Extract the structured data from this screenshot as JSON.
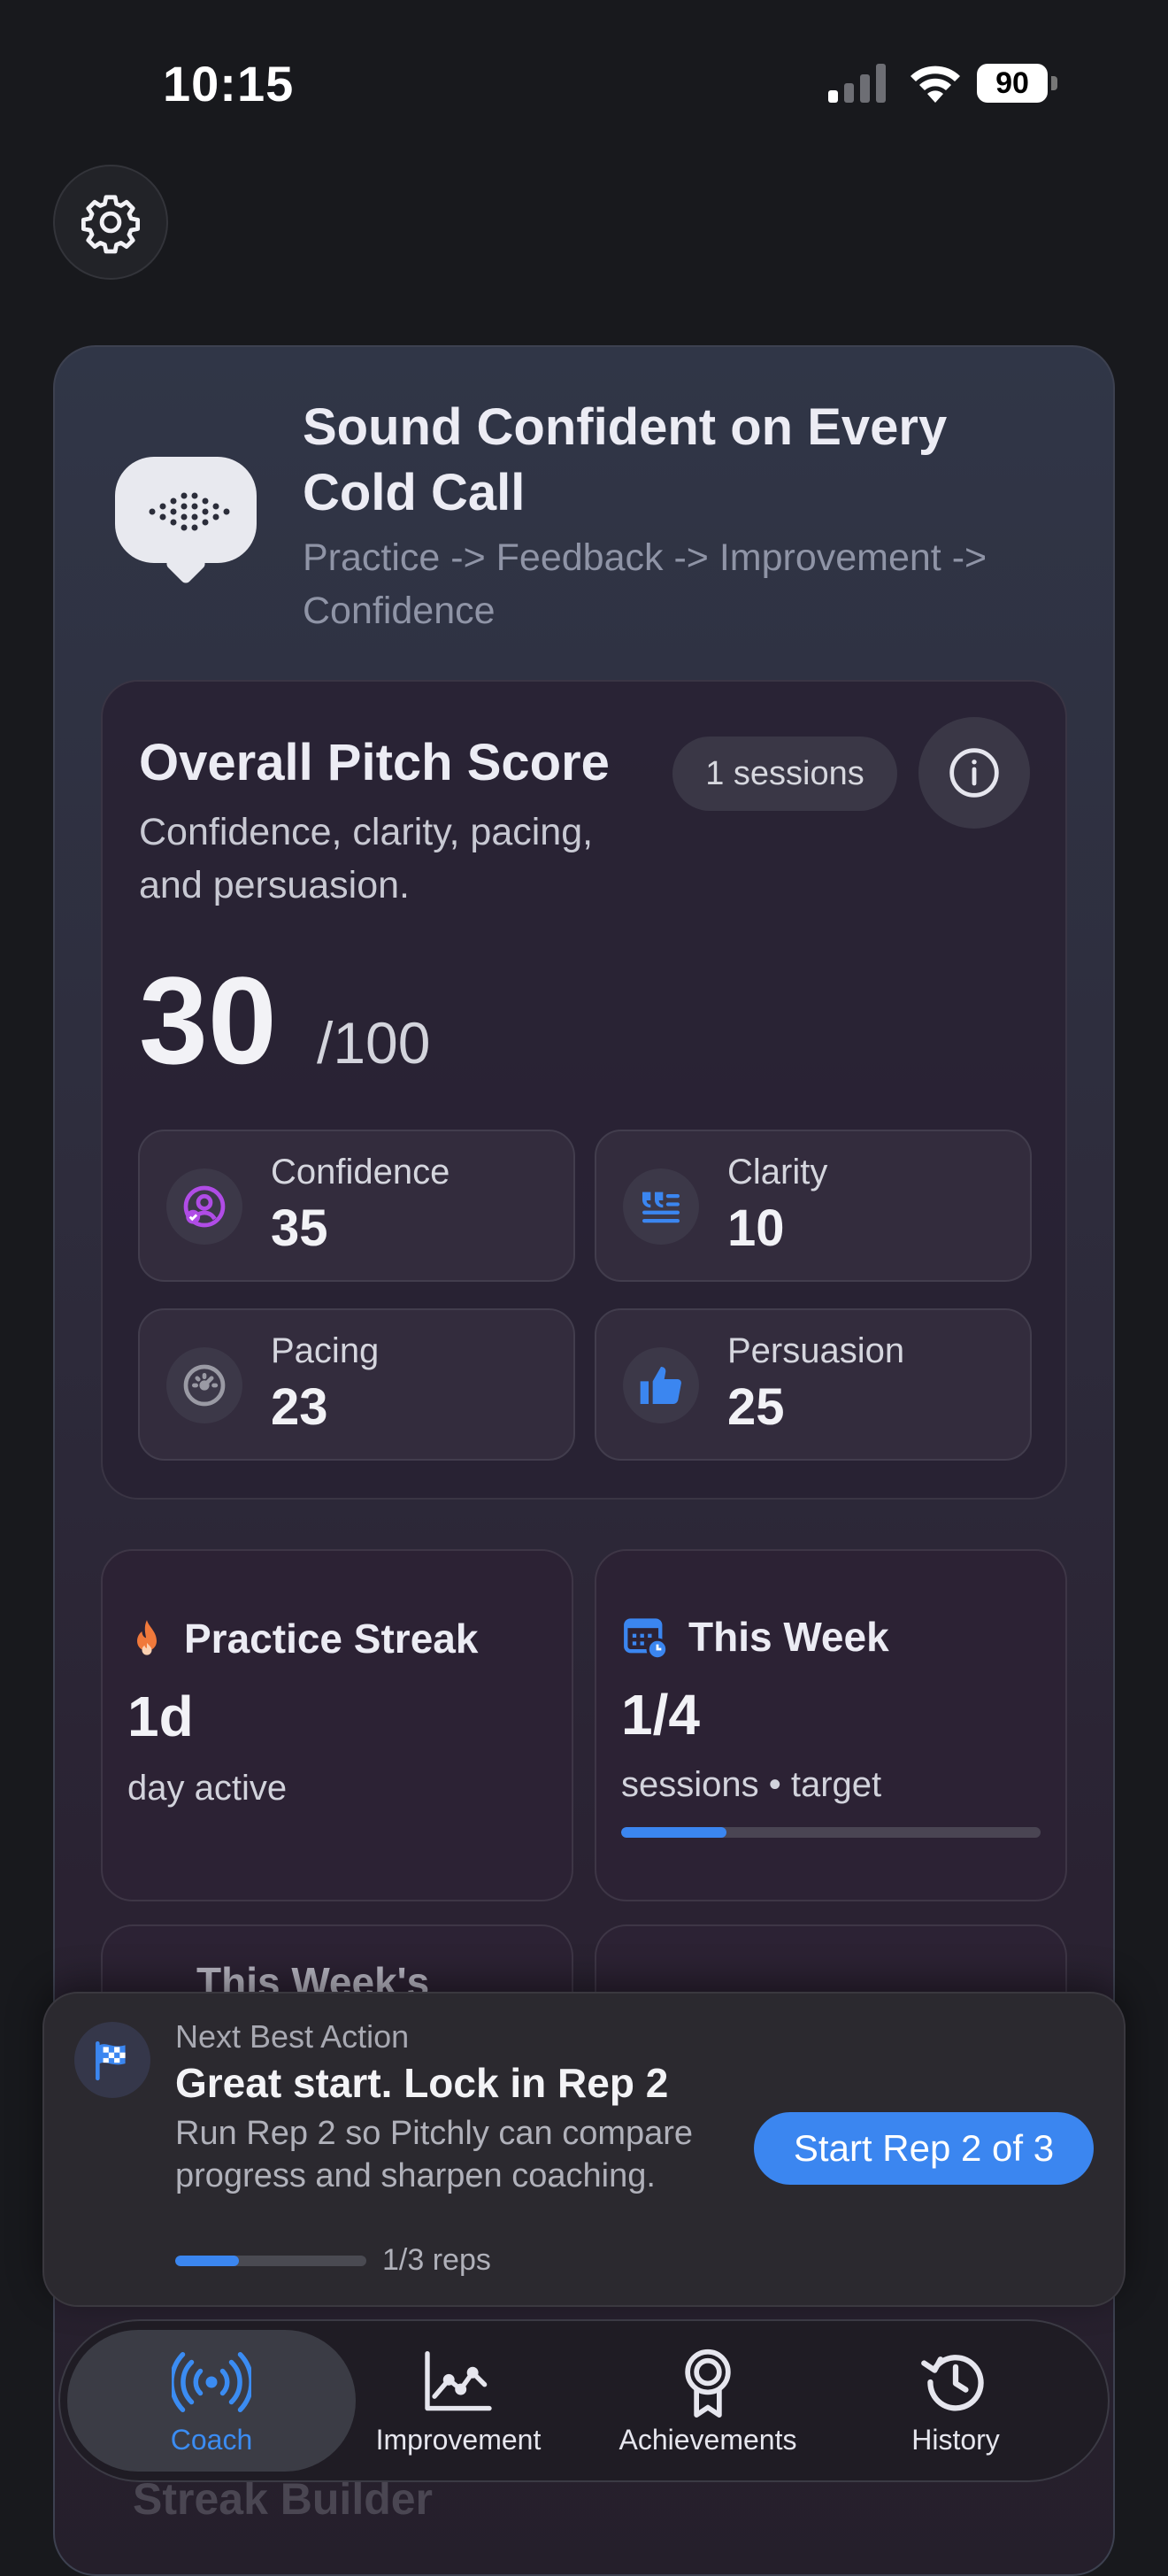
{
  "status_bar": {
    "time": "10:15",
    "battery": "90"
  },
  "header": {
    "headline": "Sound Confident on Every Cold Call",
    "subline": "Practice -> Feedback -> Improvement -> Confidence"
  },
  "score_card": {
    "title": "Overall Pitch Score",
    "description": "Confidence, clarity, pacing, and persuasion.",
    "sessions_badge": "1 sessions",
    "score": "30",
    "score_max": "/100",
    "metrics": [
      {
        "label": "Confidence",
        "value": "35",
        "icon": "confidence-icon",
        "color": "#b04ce6"
      },
      {
        "label": "Clarity",
        "value": "10",
        "icon": "clarity-quote-icon",
        "color": "#3b86f0"
      },
      {
        "label": "Pacing",
        "value": "23",
        "icon": "speedometer-icon",
        "color": "#8e8e98"
      },
      {
        "label": "Persuasion",
        "value": "25",
        "icon": "thumbs-up-icon",
        "color": "#3b86f0"
      }
    ]
  },
  "stats": {
    "streak": {
      "title": "Practice Streak",
      "value": "1d",
      "sub": "day active",
      "icon": "flame-icon",
      "color": "#f0793b"
    },
    "week": {
      "title": "This Week",
      "value": "1/4",
      "sub": "sessions • target",
      "icon": "calendar-icon",
      "progress": 0.25
    },
    "peek_title": "This Week's"
  },
  "next_action": {
    "kicker": "Next Best Action",
    "title": "Great start. Lock in Rep 2",
    "body": "Run Rep 2 so Pitchly can compare progress and sharpen coaching.",
    "progress": 0.333,
    "progress_label": "1/3 reps",
    "cta": "Start Rep 2 of 3"
  },
  "tabs": [
    {
      "label": "Coach",
      "icon": "broadcast-icon",
      "active": true
    },
    {
      "label": "Improvement",
      "icon": "line-chart-icon",
      "active": false
    },
    {
      "label": "Achievements",
      "icon": "award-ribbon-icon",
      "active": false
    },
    {
      "label": "History",
      "icon": "history-clock-icon",
      "active": false
    }
  ],
  "peek": {
    "streak_builder": "Streak Builder"
  },
  "accent": "#3b86f0"
}
